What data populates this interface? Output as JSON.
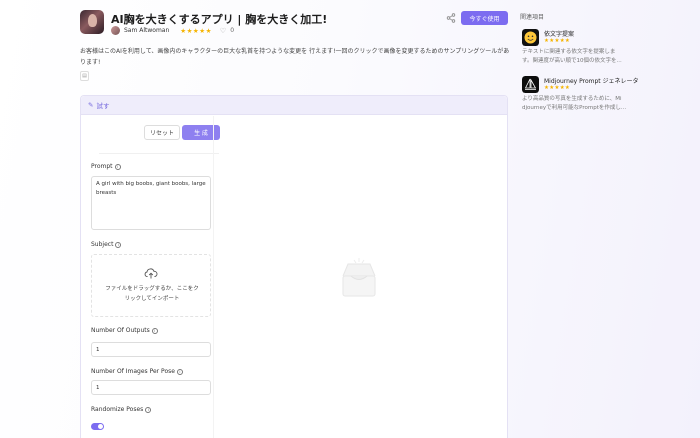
{
  "app": {
    "title": "AI胸を大きくするアプリ | 胸を大きく加工!",
    "author": "Sam Altwoman",
    "stars": "★★★★★",
    "like_count": "0",
    "use_button": "今すぐ使用",
    "description": "お客様はこのAIを利用して、画像内のキャラクターの巨大な乳首を持つような変更を 行えます!一回のクリックで画像を変更するためのサンプリングツールがあります!"
  },
  "try_panel": {
    "header": "試す",
    "reset_button": "リセット",
    "run_button": "生 成",
    "prompt_label": "Prompt",
    "prompt_value": "A girl with big boobs, giant boobs, large breasts",
    "subject_label": "Subject",
    "upload_text_line1": "ファイルをドラッグするか、ここをク",
    "upload_text_line2": "リックしてインポート",
    "num_outputs_label": "Number Of Outputs",
    "num_outputs_value": "1",
    "num_images_label": "Number Of Images Per Pose",
    "num_images_value": "1",
    "randomize_label": "Randomize Poses",
    "randomize_on": true
  },
  "related": {
    "title": "関連項目",
    "items": [
      {
        "name": "依文字提案",
        "stars": "★★★★★",
        "desc_line1": "テキストに関連する依文字を提案しま",
        "desc_line2": "す。関連度が高い順で10個の依文字を..."
      },
      {
        "name": "Midjourney Prompt ジェネレータ",
        "stars": "★★★★★",
        "desc_line1": "より高品質の写真を生成するために、Mi",
        "desc_line2": "djourneyで利用可能なPromptを作成し..."
      }
    ]
  },
  "colors": {
    "accent": "#7c6cf0",
    "star": "#f5b400"
  }
}
